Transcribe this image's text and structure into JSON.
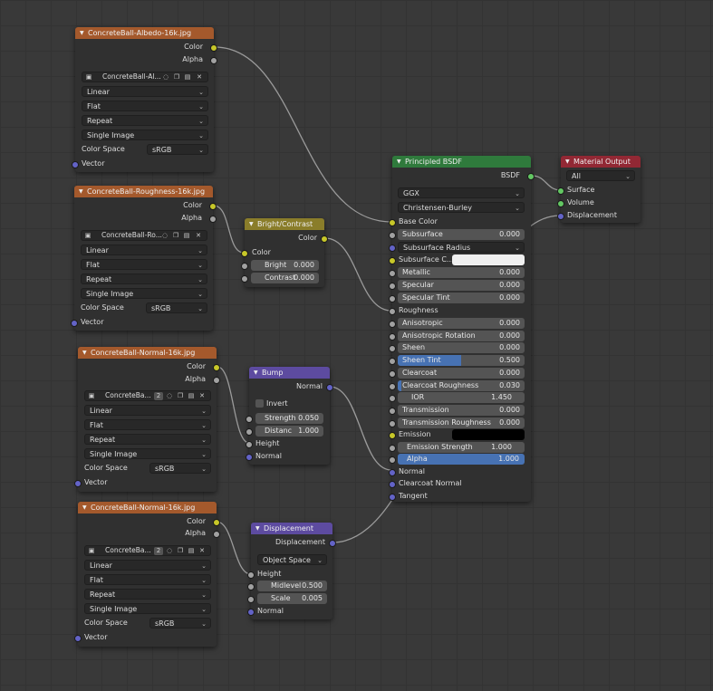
{
  "nodes": {
    "albedo": {
      "title": "ConcreteBall-Albedo-16k.jpg",
      "out_color": "Color",
      "out_alpha": "Alpha",
      "image_name": "ConcreteBall-Al...",
      "interpolation": "Linear",
      "projection": "Flat",
      "extension": "Repeat",
      "source": "Single Image",
      "color_space_label": "Color Space",
      "color_space": "sRGB",
      "in_vector": "Vector"
    },
    "roughness": {
      "title": "ConcreteBall-Roughness-16k.jpg",
      "out_color": "Color",
      "out_alpha": "Alpha",
      "image_name": "ConcreteBall-Ro...",
      "interpolation": "Linear",
      "projection": "Flat",
      "extension": "Repeat",
      "source": "Single Image",
      "color_space_label": "Color Space",
      "color_space": "sRGB",
      "in_vector": "Vector"
    },
    "normal1": {
      "title": "ConcreteBall-Normal-16k.jpg",
      "out_color": "Color",
      "out_alpha": "Alpha",
      "image_name": "ConcreteBa...",
      "users": "2",
      "interpolation": "Linear",
      "projection": "Flat",
      "extension": "Repeat",
      "source": "Single Image",
      "color_space_label": "Color Space",
      "color_space": "sRGB",
      "in_vector": "Vector"
    },
    "normal2": {
      "title": "ConcreteBall-Normal-16k.jpg",
      "out_color": "Color",
      "out_alpha": "Alpha",
      "image_name": "ConcreteBa...",
      "users": "2",
      "interpolation": "Linear",
      "projection": "Flat",
      "extension": "Repeat",
      "source": "Single Image",
      "color_space_label": "Color Space",
      "color_space": "sRGB",
      "in_vector": "Vector"
    },
    "brightcontrast": {
      "title": "Bright/Contrast",
      "out_color": "Color",
      "in_color": "Color",
      "bright_label": "Bright",
      "bright": "0.000",
      "contrast_label": "Contrast",
      "contrast": "0.000"
    },
    "bump": {
      "title": "Bump",
      "out_normal": "Normal",
      "invert": "Invert",
      "strength_label": "Strength",
      "strength": "0.050",
      "distance_label": "Distanc",
      "distance": "1.000",
      "in_height": "Height",
      "in_normal": "Normal"
    },
    "displacement": {
      "title": "Displacement",
      "out_displacement": "Displacement",
      "space": "Object Space",
      "in_height": "Height",
      "midlevel_label": "Midlevel",
      "midlevel": "0.500",
      "scale_label": "Scale",
      "scale": "0.005",
      "in_normal": "Normal"
    },
    "bsdf": {
      "title": "Principled BSDF",
      "out_bsdf": "BSDF",
      "distribution": "GGX",
      "subsurface_method": "Christensen-Burley",
      "base_color": "Base Color",
      "subsurface_label": "Subsurface",
      "subsurface": "0.000",
      "subsurface_radius": "Subsurface Radius",
      "subsurface_color": "Subsurface C...",
      "metallic_label": "Metallic",
      "metallic": "0.000",
      "specular_label": "Specular",
      "specular": "0.000",
      "specular_tint_label": "Specular Tint",
      "specular_tint": "0.000",
      "roughness": "Roughness",
      "anisotropic_label": "Anisotropic",
      "anisotropic": "0.000",
      "aniso_rot_label": "Anisotropic Rotation",
      "aniso_rot": "0.000",
      "sheen_label": "Sheen",
      "sheen": "0.000",
      "sheen_tint_label": "Sheen Tint",
      "sheen_tint": "0.500",
      "clearcoat_label": "Clearcoat",
      "clearcoat": "0.000",
      "clearcoat_rough_label": "Clearcoat Roughness",
      "clearcoat_rough": "0.030",
      "ior_label": "IOR",
      "ior": "1.450",
      "transmission_label": "Transmission",
      "transmission": "0.000",
      "trans_rough_label": "Transmission Roughness",
      "trans_rough": "0.000",
      "emission": "Emission",
      "emission_strength_label": "Emission Strength",
      "emission_strength": "1.000",
      "alpha_label": "Alpha",
      "alpha": "1.000",
      "in_normal": "Normal",
      "in_clearcoat_normal": "Clearcoat Normal",
      "in_tangent": "Tangent"
    },
    "output": {
      "title": "Material Output",
      "target": "All",
      "in_surface": "Surface",
      "in_volume": "Volume",
      "in_displacement": "Displacement"
    }
  },
  "colors": {
    "texture_header": "#a4592c",
    "color_header": "#8a7d2a",
    "vector_header": "#5d4ba0",
    "shader_header": "#2f7a3c",
    "output_header": "#922834",
    "link": "#9a9a9a"
  }
}
